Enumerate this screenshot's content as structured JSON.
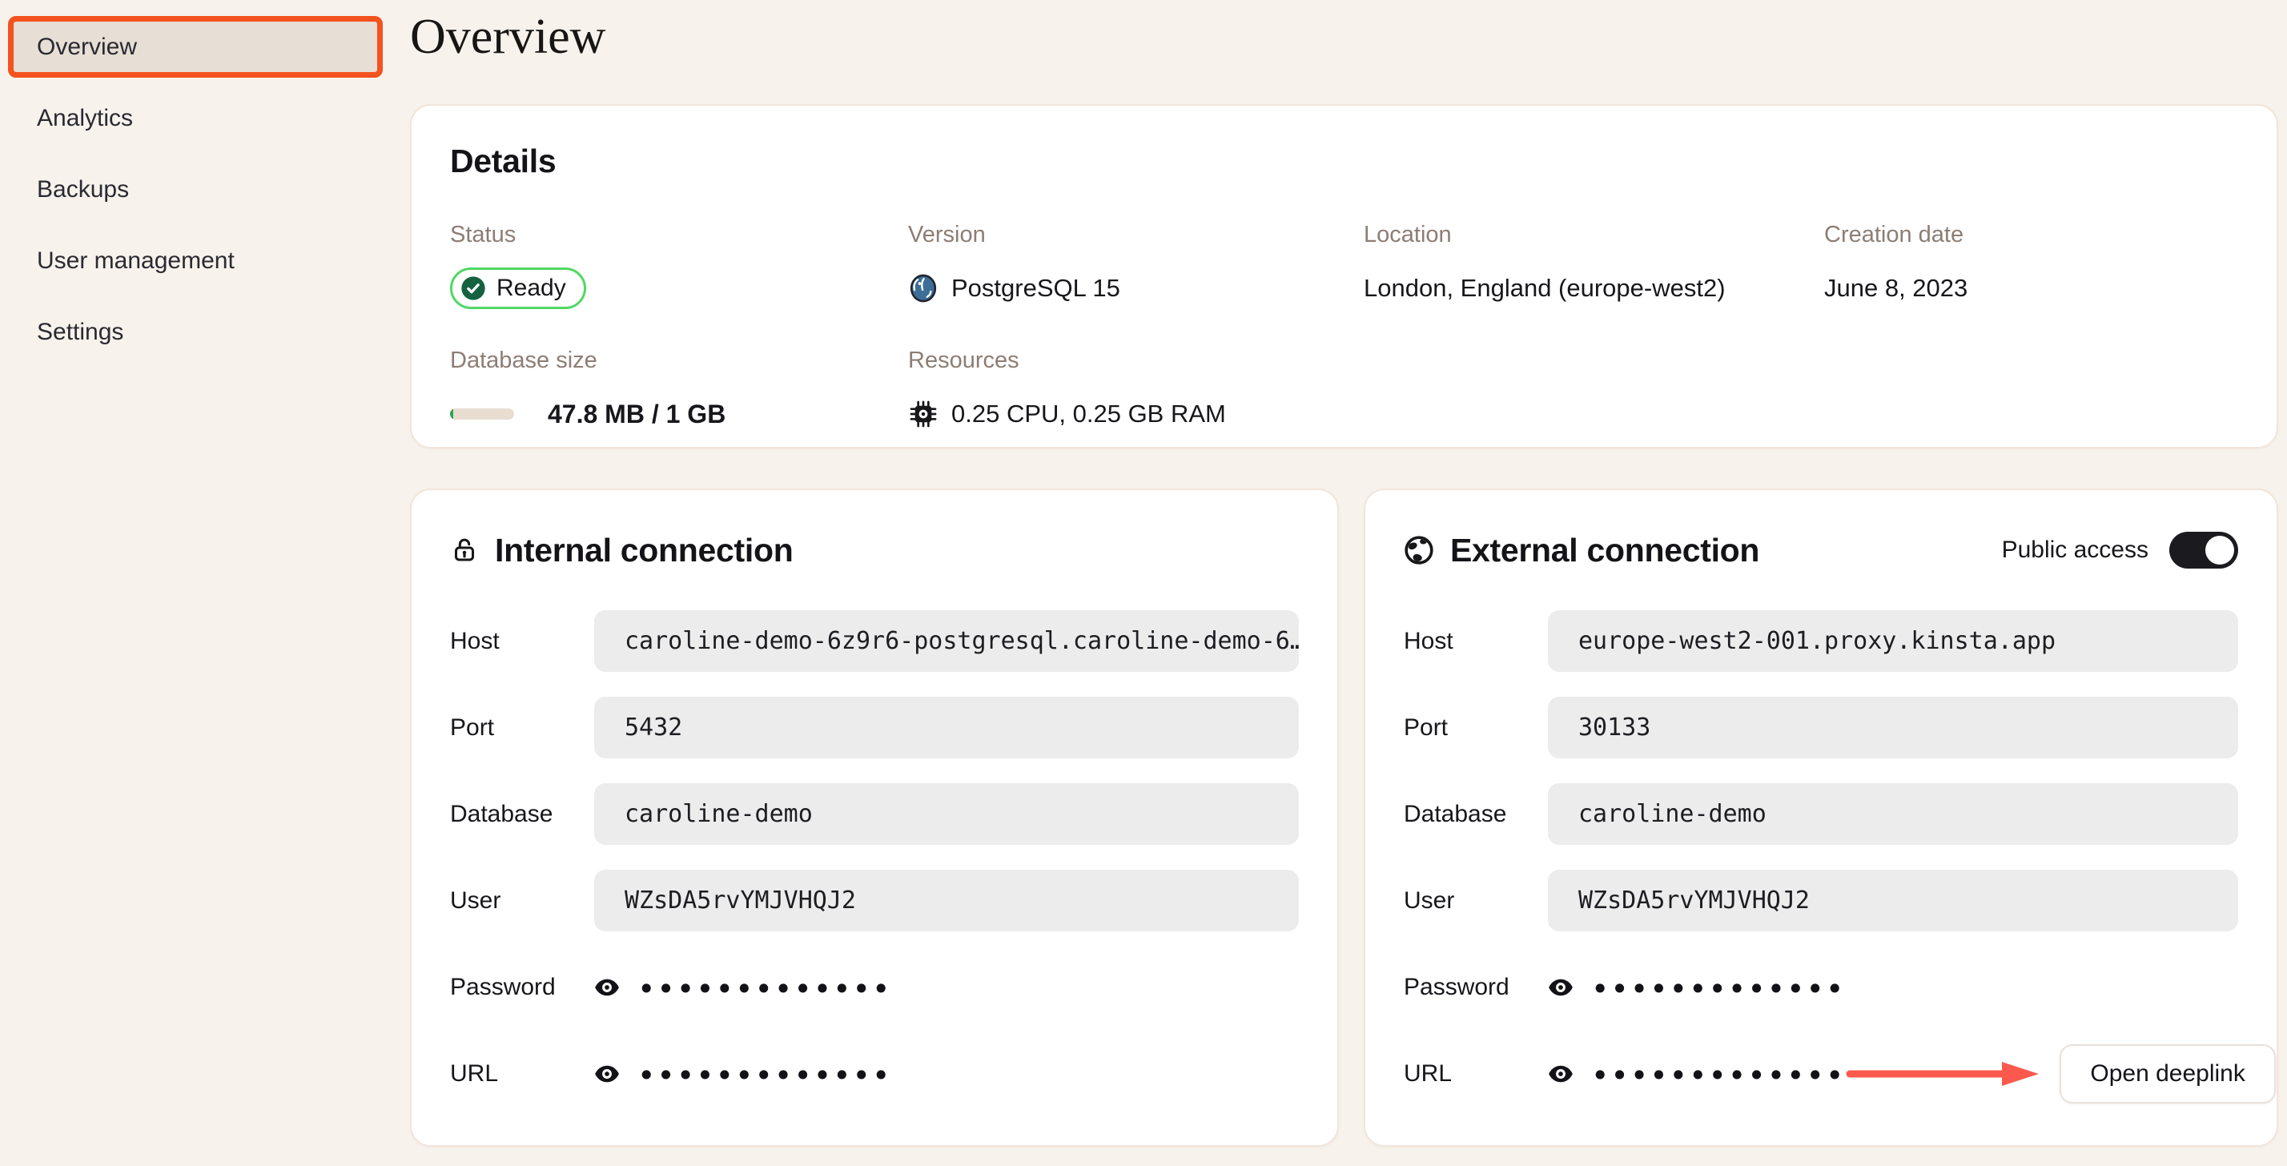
{
  "colors": {
    "background": "#f7f2ec",
    "accent_orange": "#f4521e",
    "status_green_border": "#4fd863",
    "status_green_dark": "#156240",
    "progress_green": "#2da44e",
    "arrow_red": "#fb594d",
    "postgres_blue": "#3d6e98"
  },
  "sidebar": {
    "items": [
      {
        "label": "Overview",
        "selected": true
      },
      {
        "label": "Analytics",
        "selected": false
      },
      {
        "label": "Backups",
        "selected": false
      },
      {
        "label": "User management",
        "selected": false
      },
      {
        "label": "Settings",
        "selected": false
      }
    ]
  },
  "page_title": "Overview",
  "details": {
    "heading": "Details",
    "status_label": "Status",
    "status_value": "Ready",
    "version_label": "Version",
    "version_value": "PostgreSQL 15",
    "location_label": "Location",
    "location_value": "London, England (europe-west2)",
    "creation_label": "Creation date",
    "creation_value": "June 8, 2023",
    "db_size_label": "Database size",
    "db_size_value": "47.8 MB / 1 GB",
    "db_size_percent": 4.7,
    "resources_label": "Resources",
    "resources_value": "0.25 CPU, 0.25 GB RAM"
  },
  "internal": {
    "heading": "Internal connection",
    "host_label": "Host",
    "host_value": "caroline-demo-6z9r6-postgresql.caroline-demo-6…",
    "port_label": "Port",
    "port_value": "5432",
    "database_label": "Database",
    "database_value": "caroline-demo",
    "user_label": "User",
    "user_value": "WZsDA5rvYMJVHQJ2",
    "password_label": "Password",
    "password_mask": "•••••••••••••",
    "url_label": "URL",
    "url_mask": "•••••••••••••"
  },
  "external": {
    "heading": "External connection",
    "public_access_label": "Public access",
    "public_access_on": true,
    "host_label": "Host",
    "host_value": "europe-west2-001.proxy.kinsta.app",
    "port_label": "Port",
    "port_value": "30133",
    "database_label": "Database",
    "database_value": "caroline-demo",
    "user_label": "User",
    "user_value": "WZsDA5rvYMJVHQJ2",
    "password_label": "Password",
    "password_mask": "•••••••••••••",
    "url_label": "URL",
    "url_mask": "•••••••••••••",
    "open_deeplink_label": "Open deeplink"
  }
}
